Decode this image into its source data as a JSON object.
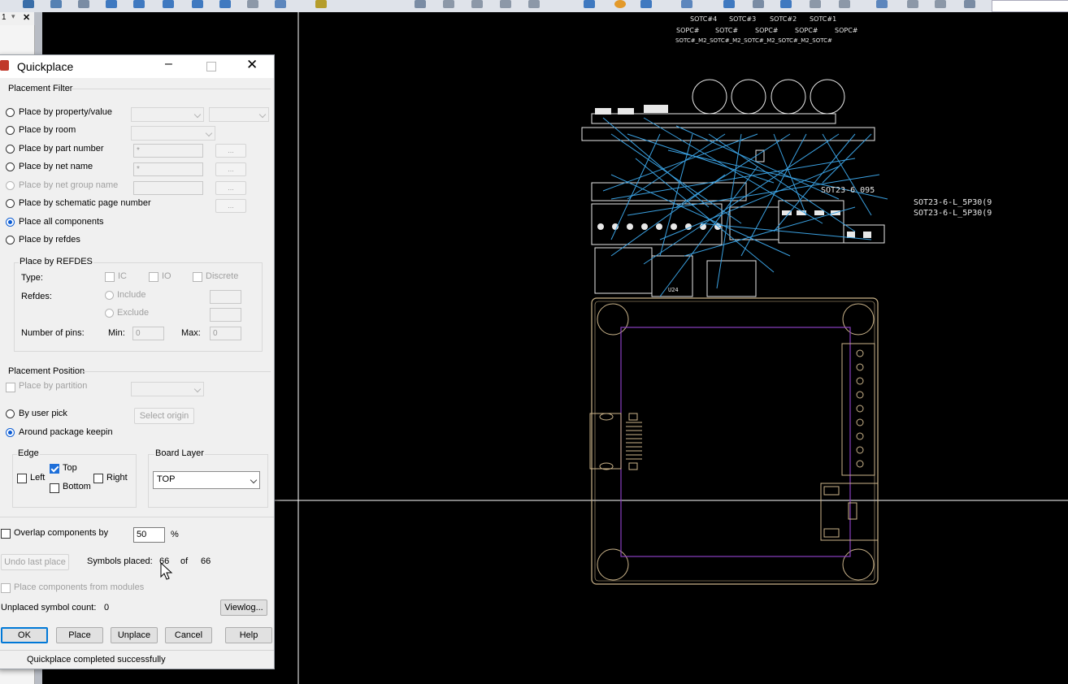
{
  "window": {
    "side_panel_tab": "1"
  },
  "dialog": {
    "title": "Quickplace",
    "placement_filter": {
      "heading": "Placement Filter",
      "options": [
        "Place by property/value",
        "Place by room",
        "Place by part number",
        "Place by net name",
        "Place by net group name",
        "Place by schematic page number",
        "Place all components",
        "Place by refdes"
      ],
      "selected": "Place all components",
      "part_number_value": "*",
      "net_name_value": "*",
      "browse_label": "..."
    },
    "refdes_group": {
      "heading": "Place by REFDES",
      "type_label": "Type:",
      "type_options": [
        "IC",
        "IO",
        "Discrete"
      ],
      "refdes_label": "Refdes:",
      "include_label": "Include",
      "exclude_label": "Exclude",
      "num_pins_label": "Number of pins:",
      "min_label": "Min:",
      "min_value": "0",
      "max_label": "Max:",
      "max_value": "0"
    },
    "placement_position": {
      "heading": "Placement Position",
      "place_by_partition": "Place by partition",
      "by_user_pick": "By user pick",
      "select_origin": "Select origin",
      "around_keepin": "Around package keepin",
      "selected": "Around package keepin"
    },
    "edge": {
      "heading": "Edge",
      "left": "Left",
      "top": "Top",
      "right": "Right",
      "bottom": "Bottom",
      "top_checked": true
    },
    "board_layer": {
      "heading": "Board Layer",
      "value": "TOP"
    },
    "overlap": {
      "label": "Overlap components by",
      "value": "50",
      "unit": "%"
    },
    "undo_last_place": "Undo last place",
    "symbols_placed_label": "Symbols placed:",
    "symbols_placed": "66",
    "of_label": "of",
    "symbols_total": "66",
    "place_from_modules": "Place components from modules",
    "unplaced_label": "Unplaced symbol count:",
    "unplaced_count": "0",
    "viewlog": "Viewlog...",
    "buttons": {
      "ok": "OK",
      "place": "Place",
      "unplace": "Unplace",
      "cancel": "Cancel",
      "help": "Help"
    },
    "status": "Quickplace completed successfully"
  },
  "canvas_labels": {
    "top_row1": [
      "SOTC#4",
      "SOTC#3",
      "SOTC#2",
      "SOTC#1"
    ],
    "top_row2": [
      "SOPC#",
      "SOTC#",
      "SOPC#",
      "SOPC#",
      "SOPC#"
    ],
    "top_row3": "SOTC#_M2_SOTC#_M2_SOTC#_M2_SOTC#_M2_SOTC#",
    "part1": "SOT23-6-L_5P30(9",
    "part2": "SOT23-6-L_5P30(9",
    "part3": "SOT23-6 095",
    "ref_u": "U24"
  },
  "colors": {
    "canvas_bg": "#000000",
    "ratsnest": "#3aa0e0",
    "board_outline": "#cbb48a",
    "keepin": "#8a3fc0",
    "component": "#e8e8e8",
    "crosshair": "#ffffff"
  }
}
